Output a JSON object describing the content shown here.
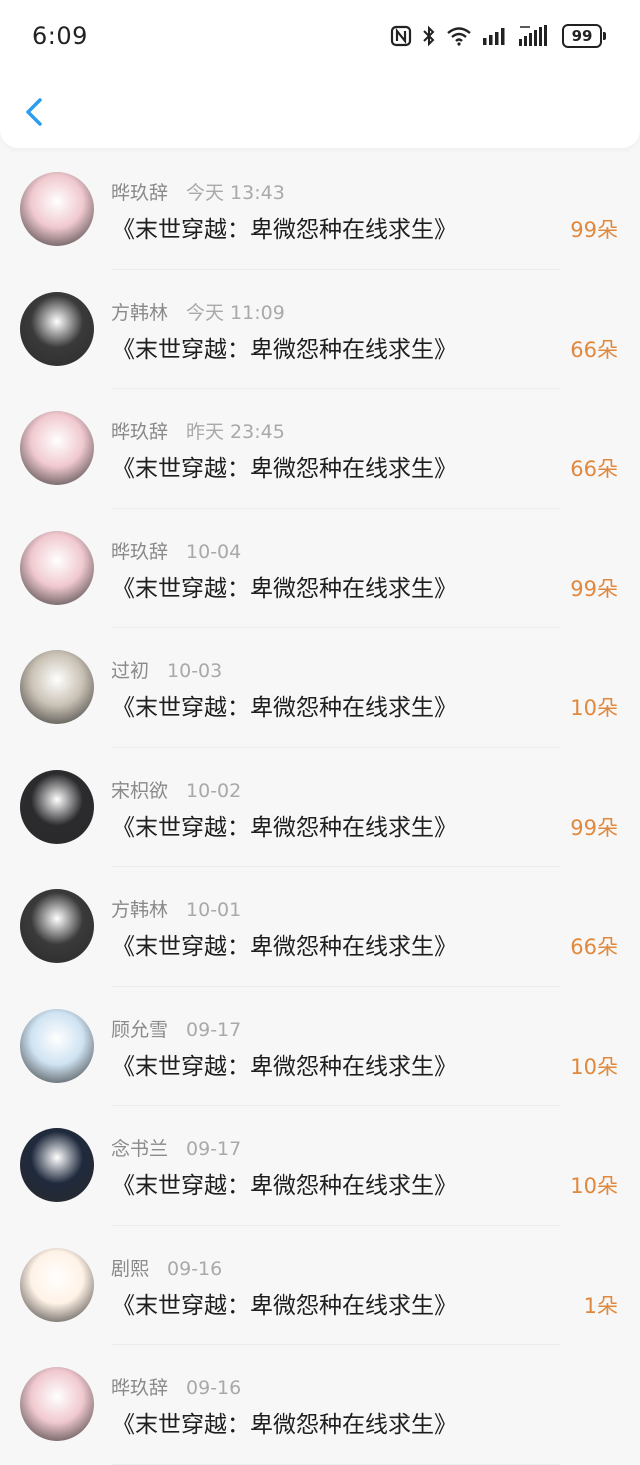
{
  "status_bar": {
    "time": "6:09",
    "battery": "99"
  },
  "nav": {
    "back_icon": "chevron-left-icon"
  },
  "records": [
    {
      "name": "晔玖辞",
      "date": "今天 13:43",
      "title": "《末世穿越：卑微怨种在线求生》",
      "amount": "99朵",
      "avatar_color": "#f0c9cf"
    },
    {
      "name": "方韩林",
      "date": "今天 11:09",
      "title": "《末世穿越：卑微怨种在线求生》",
      "amount": "66朵",
      "avatar_color": "#3a3a3a"
    },
    {
      "name": "晔玖辞",
      "date": "昨天 23:45",
      "title": "《末世穿越：卑微怨种在线求生》",
      "amount": "66朵",
      "avatar_color": "#f0c9cf"
    },
    {
      "name": "晔玖辞",
      "date": "10-04",
      "title": "《末世穿越：卑微怨种在线求生》",
      "amount": "99朵",
      "avatar_color": "#f0c9cf"
    },
    {
      "name": "过初",
      "date": "10-03",
      "title": "《末世穿越：卑微怨种在线求生》",
      "amount": "10朵",
      "avatar_color": "#c9c1b4"
    },
    {
      "name": "宋枳欲",
      "date": "10-02",
      "title": "《末世穿越：卑微怨种在线求生》",
      "amount": "99朵",
      "avatar_color": "#2b2b2e"
    },
    {
      "name": "方韩林",
      "date": "10-01",
      "title": "《末世穿越：卑微怨种在线求生》",
      "amount": "66朵",
      "avatar_color": "#3a3a3a"
    },
    {
      "name": "顾允雪",
      "date": "09-17",
      "title": "《末世穿越：卑微怨种在线求生》",
      "amount": "10朵",
      "avatar_color": "#cfe3f2"
    },
    {
      "name": "念书兰",
      "date": "09-17",
      "title": "《末世穿越：卑微怨种在线求生》",
      "amount": "10朵",
      "avatar_color": "#1f2a3d"
    },
    {
      "name": "剧熙",
      "date": "09-16",
      "title": "《末世穿越：卑微怨种在线求生》",
      "amount": "1朵",
      "avatar_color": "#fff2e6"
    },
    {
      "name": "晔玖辞",
      "date": "09-16",
      "title": "《末世穿越：卑微怨种在线求生》",
      "amount": "",
      "avatar_color": "#f0c9cf"
    }
  ],
  "accent_color": "#e0883c",
  "back_color": "#2e9df0"
}
